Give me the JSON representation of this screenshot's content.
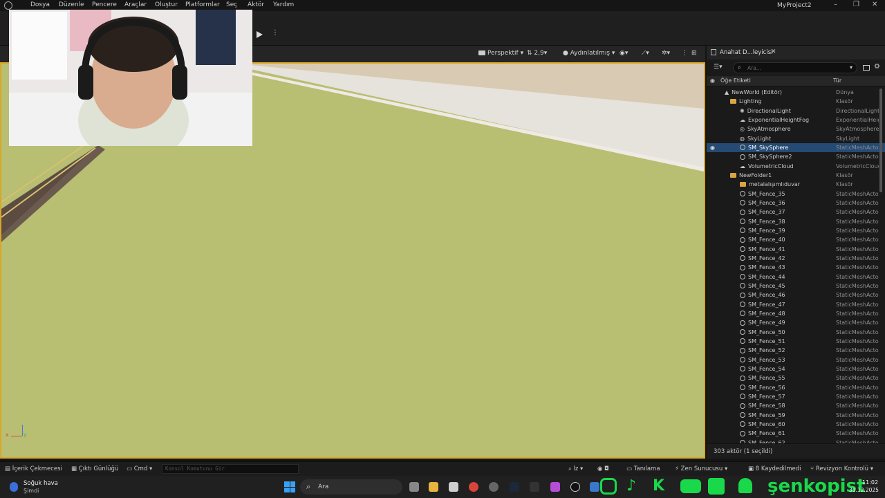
{
  "menu": {
    "items": [
      "Dosya",
      "Düzenle",
      "Pencere",
      "Araçlar",
      "Oluştur",
      "Platformlar",
      "Seç",
      "Aktör",
      "Yardım"
    ],
    "project_title": "MyProject2"
  },
  "viewport": {
    "perspective_label": "Perspektif",
    "camera_speed": "2,9",
    "lighting_label": "Aydınlatılmış",
    "axis_x": "x",
    "axis_y": "y"
  },
  "outliner": {
    "tab_title": "Anahat D...leyicisi",
    "search_placeholder": "Ara...",
    "col_label": "Öğe Etiketi",
    "col_type": "Tür",
    "rows": [
      {
        "name": "NewWorld (Editör)",
        "type": "Dünya",
        "indent": 1,
        "icon": "world-icon"
      },
      {
        "name": "Lighting",
        "type": "Klasör",
        "indent": 2,
        "icon": "folder-icon"
      },
      {
        "name": "DirectionalLight",
        "type": "DirectionalLight",
        "indent": 3,
        "icon": "light-icon"
      },
      {
        "name": "ExponentialHeightFog",
        "type": "ExponentialHeig",
        "indent": 3,
        "icon": "fog-icon"
      },
      {
        "name": "SkyAtmosphere",
        "type": "SkyAtmosphere",
        "indent": 3,
        "icon": "sky-icon"
      },
      {
        "name": "SkyLight",
        "type": "SkyLight",
        "indent": 3,
        "icon": "skylight-icon"
      },
      {
        "name": "SM_SkySphere",
        "type": "StaticMeshActo",
        "indent": 3,
        "icon": "mesh-icon",
        "selected": true
      },
      {
        "name": "SM_SkySphere2",
        "type": "StaticMeshActo",
        "indent": 3,
        "icon": "mesh-icon"
      },
      {
        "name": "VolumetricCloud",
        "type": "VolumetricClouc",
        "indent": 3,
        "icon": "cloud-icon"
      },
      {
        "name": "NewFolder1",
        "type": "Klasör",
        "indent": 2,
        "icon": "folder-icon"
      },
      {
        "name": "metalalışımlıduvar",
        "type": "Klasör",
        "indent": 3,
        "icon": "folder-icon"
      },
      {
        "name": "SM_Fence_35",
        "type": "StaticMeshActo",
        "indent": 3,
        "icon": "mesh-icon"
      },
      {
        "name": "SM_Fence_36",
        "type": "StaticMeshActo",
        "indent": 3,
        "icon": "mesh-icon"
      },
      {
        "name": "SM_Fence_37",
        "type": "StaticMeshActo",
        "indent": 3,
        "icon": "mesh-icon"
      },
      {
        "name": "SM_Fence_38",
        "type": "StaticMeshActo",
        "indent": 3,
        "icon": "mesh-icon"
      },
      {
        "name": "SM_Fence_39",
        "type": "StaticMeshActo",
        "indent": 3,
        "icon": "mesh-icon"
      },
      {
        "name": "SM_Fence_40",
        "type": "StaticMeshActo",
        "indent": 3,
        "icon": "mesh-icon"
      },
      {
        "name": "SM_Fence_41",
        "type": "StaticMeshActo",
        "indent": 3,
        "icon": "mesh-icon"
      },
      {
        "name": "SM_Fence_42",
        "type": "StaticMeshActo",
        "indent": 3,
        "icon": "mesh-icon"
      },
      {
        "name": "SM_Fence_43",
        "type": "StaticMeshActo",
        "indent": 3,
        "icon": "mesh-icon"
      },
      {
        "name": "SM_Fence_44",
        "type": "StaticMeshActo",
        "indent": 3,
        "icon": "mesh-icon"
      },
      {
        "name": "SM_Fence_45",
        "type": "StaticMeshActo",
        "indent": 3,
        "icon": "mesh-icon"
      },
      {
        "name": "SM_Fence_46",
        "type": "StaticMeshActo",
        "indent": 3,
        "icon": "mesh-icon"
      },
      {
        "name": "SM_Fence_47",
        "type": "StaticMeshActo",
        "indent": 3,
        "icon": "mesh-icon"
      },
      {
        "name": "SM_Fence_48",
        "type": "StaticMeshActo",
        "indent": 3,
        "icon": "mesh-icon"
      },
      {
        "name": "SM_Fence_49",
        "type": "StaticMeshActo",
        "indent": 3,
        "icon": "mesh-icon"
      },
      {
        "name": "SM_Fence_50",
        "type": "StaticMeshActo",
        "indent": 3,
        "icon": "mesh-icon"
      },
      {
        "name": "SM_Fence_51",
        "type": "StaticMeshActo",
        "indent": 3,
        "icon": "mesh-icon"
      },
      {
        "name": "SM_Fence_52",
        "type": "StaticMeshActo",
        "indent": 3,
        "icon": "mesh-icon"
      },
      {
        "name": "SM_Fence_53",
        "type": "StaticMeshActo",
        "indent": 3,
        "icon": "mesh-icon"
      },
      {
        "name": "SM_Fence_54",
        "type": "StaticMeshActo",
        "indent": 3,
        "icon": "mesh-icon"
      },
      {
        "name": "SM_Fence_55",
        "type": "StaticMeshActo",
        "indent": 3,
        "icon": "mesh-icon"
      },
      {
        "name": "SM_Fence_56",
        "type": "StaticMeshActo",
        "indent": 3,
        "icon": "mesh-icon"
      },
      {
        "name": "SM_Fence_57",
        "type": "StaticMeshActo",
        "indent": 3,
        "icon": "mesh-icon"
      },
      {
        "name": "SM_Fence_58",
        "type": "StaticMeshActo",
        "indent": 3,
        "icon": "mesh-icon"
      },
      {
        "name": "SM_Fence_59",
        "type": "StaticMeshActo",
        "indent": 3,
        "icon": "mesh-icon"
      },
      {
        "name": "SM_Fence_60",
        "type": "StaticMeshActo",
        "indent": 3,
        "icon": "mesh-icon"
      },
      {
        "name": "SM_Fence_61",
        "type": "StaticMeshActo",
        "indent": 3,
        "icon": "mesh-icon"
      },
      {
        "name": "SM_Fence_62",
        "type": "StaticMeshActo",
        "indent": 3,
        "icon": "mesh-icon"
      }
    ],
    "footer": "303 aktör (1 seçildi)"
  },
  "statusbar": {
    "content_drawer": "İçerik Çekmecesi",
    "output_log": "Çıktı Günlüğü",
    "cmd": "Cmd",
    "console_placeholder": "Konsol Komutunu Gir",
    "trace": "Tanılama",
    "zen": "Zen Sunucusu",
    "unsaved": "8 Kaydedilmedi",
    "revision": "Revizyon Kontrolü"
  },
  "taskbar": {
    "weather_title": "Soğuk hava",
    "weather_sub": "Şimdi",
    "search_label": "Ara",
    "time": "11:02",
    "date": "31.12.2025"
  },
  "overlay": {
    "channel_name": "şenkopist"
  },
  "colors": {
    "viewport_ground": "#b8be72",
    "selection": "#254a74",
    "viewport_border": "#d9a726"
  }
}
